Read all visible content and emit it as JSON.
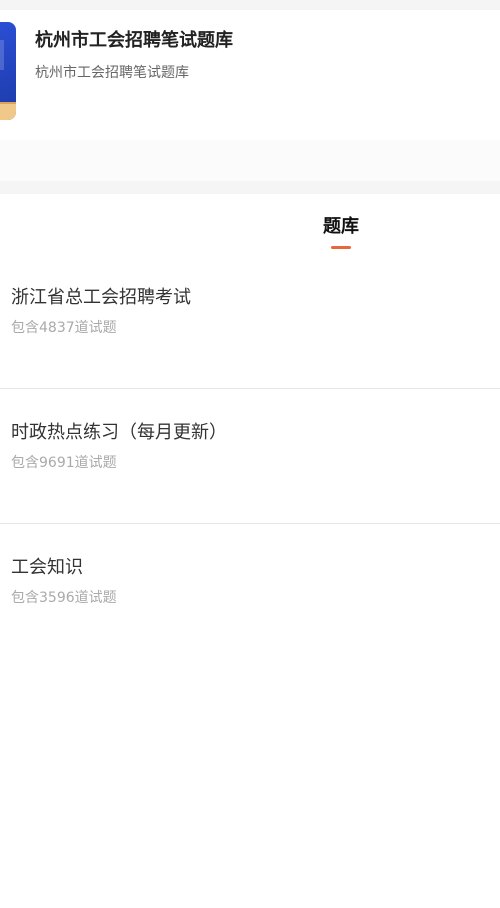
{
  "header": {
    "title": "杭州市工会招聘笔试题库",
    "subtitle": "杭州市工会招聘笔试题库",
    "cover_colors": [
      "#2b4fd6",
      "#f0c88a"
    ]
  },
  "tabs": [
    {
      "label": "题库",
      "active": true,
      "underline_color": "#e8673b"
    }
  ],
  "question_banks": [
    {
      "name": "浙江省总工会招聘考试",
      "count": "包含4837道试题"
    },
    {
      "name": "时政热点练习（每月更新）",
      "count": "包含9691道试题"
    },
    {
      "name": "工会知识",
      "count": "包含3596道试题"
    }
  ]
}
